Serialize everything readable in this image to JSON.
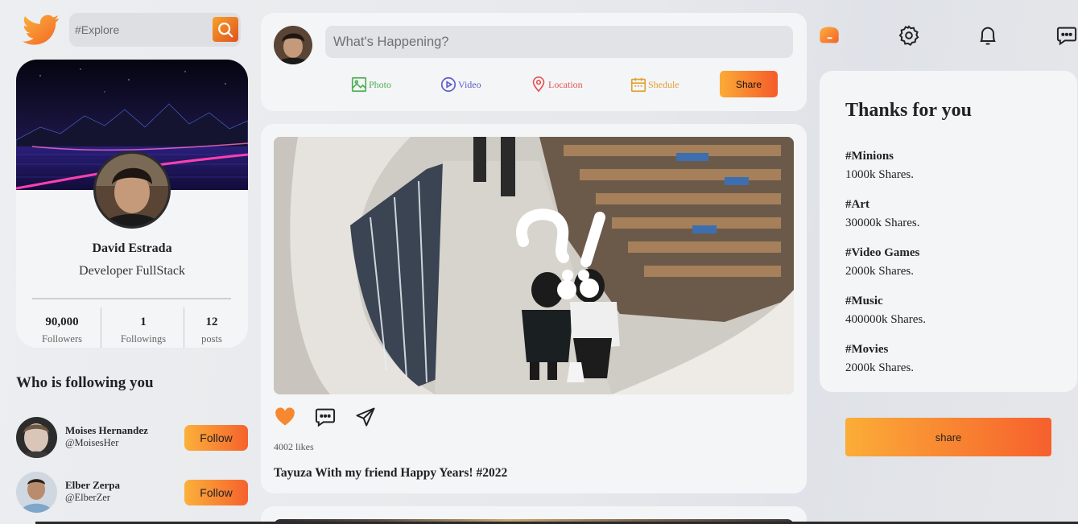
{
  "search": {
    "placeholder": "#Explore"
  },
  "profile": {
    "name": "David Estrada",
    "role": "Developer FullStack",
    "stats": [
      {
        "value": "90,000",
        "label": "Followers"
      },
      {
        "value": "1",
        "label": "Followings"
      },
      {
        "value": "12",
        "label": "posts"
      }
    ]
  },
  "who_following": {
    "title": "Who is following you",
    "items": [
      {
        "name": "Moises Hernandez",
        "handle": "@MoisesHer",
        "button": "Follow"
      },
      {
        "name": "Elber Zerpa",
        "handle": "@ElberZer",
        "button": "Follow"
      }
    ]
  },
  "compose": {
    "placeholder": "What's Happening?",
    "options": {
      "photo": "Photo",
      "video": "Video",
      "location": "Location",
      "schedule": "Shedule"
    },
    "share_label": "Share"
  },
  "post": {
    "likes": "4002 likes",
    "caption": "Tayuza With my friend Happy Years! #2022"
  },
  "trends": {
    "title": "Thanks for you",
    "items": [
      {
        "tag": "#Minions",
        "shares": "1000k Shares."
      },
      {
        "tag": "#Art",
        "shares": "30000k Shares."
      },
      {
        "tag": "#Video Games",
        "shares": "2000k Shares."
      },
      {
        "tag": "#Music",
        "shares": "400000k Shares."
      },
      {
        "tag": "#Movies",
        "shares": "2000k Shares."
      }
    ],
    "share_label": "share"
  },
  "colors": {
    "accent": "#f7882f",
    "accent_dark": "#f55b2a",
    "photo": "#4caf50",
    "video": "#5c5cc8",
    "location": "#e55353",
    "schedule": "#e0a030"
  },
  "icons": [
    "twitter-logo-icon",
    "search-icon",
    "photo-icon",
    "video-icon",
    "location-icon",
    "calendar-icon",
    "heart-icon",
    "comment-icon",
    "send-icon",
    "home-icon",
    "settings-icon",
    "bell-icon",
    "message-icon"
  ]
}
